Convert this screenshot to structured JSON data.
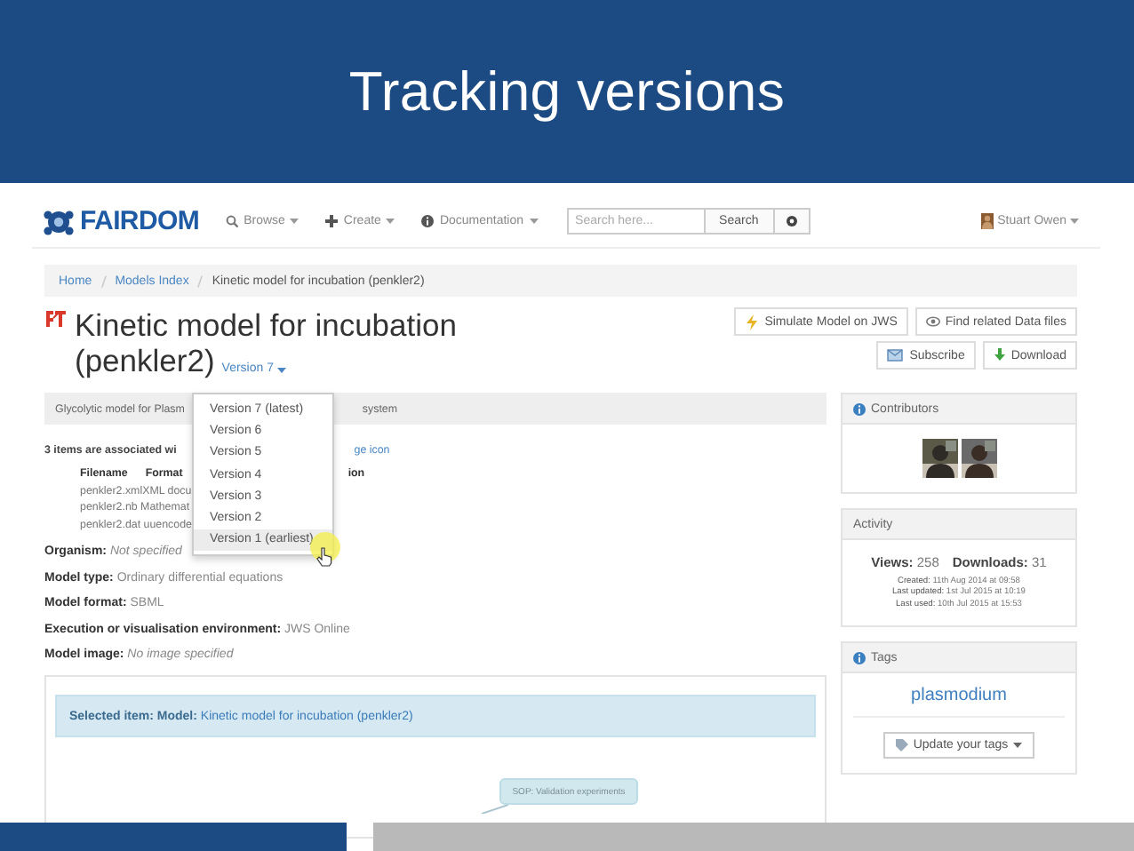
{
  "slide": {
    "title": "Tracking versions"
  },
  "navbar": {
    "logo": "FAIRDOM",
    "menus": [
      {
        "label": "Browse"
      },
      {
        "label": "Create"
      },
      {
        "label": "Documentation"
      }
    ],
    "search": {
      "placeholder": "Search here...",
      "button": "Search"
    },
    "user": "Stuart Owen"
  },
  "breadcrumb": [
    "Home",
    "Models Index",
    "Kinetic model for incubation (penkler2)"
  ],
  "title": [
    "Kinetic model for incubation",
    "(penkler2)"
  ],
  "version_menu": {
    "label": "Version 7",
    "expanded": true,
    "items": [
      {
        "label": "Version 7 (latest)",
        "selected": false
      },
      {
        "label": "Version 6",
        "selected": false
      },
      {
        "label": "Version 5",
        "selected": false
      },
      {
        "label": "Version 4",
        "selected": false
      },
      {
        "label": "Version 3",
        "selected": false
      },
      {
        "label": "Version 2",
        "selected": false
      },
      {
        "label": "Version 1 (earliest)",
        "selected": true
      }
    ]
  },
  "actions": [
    {
      "label": "Simulate Model on JWS"
    },
    {
      "label": "Find related Data files"
    },
    {
      "label": "Subscribe"
    },
    {
      "label": "Download"
    }
  ],
  "description": {
    "left": "Glycolytic model for Plasm",
    "right": "system"
  },
  "associated": {
    "text": "3 items are associated wi",
    "link": "ge icon"
  },
  "files": {
    "columns": [
      "Filename",
      "Format",
      "ion"
    ],
    "rows": [
      "penkler2.xmlXML docu",
      "penkler2.nb Mathemat",
      "penkler2.dat uuencode"
    ]
  },
  "fields": [
    {
      "label": "Organism:",
      "value": "Not specified",
      "kind": "empty"
    },
    {
      "label": "Model type:",
      "value": "Ordinary differential equations",
      "kind": "value"
    },
    {
      "label": "Model format:",
      "value": "SBML",
      "kind": "value"
    },
    {
      "label": "Execution or visualisation environment:",
      "value": "JWS Online",
      "kind": "value"
    },
    {
      "label": "Model image:",
      "value": "No image specified",
      "kind": "empty"
    }
  ],
  "selected_item": "**Selected item: Model:** Kinetic model for incubation (penkler2)",
  "graph": {
    "nodes": [
      "SOP: Validation experiments"
    ]
  },
  "sidebar": {
    "contributors": {
      "title": "Contributors"
    },
    "activity": {
      "title": "Activity",
      "views_label": "Views:",
      "views": "258",
      "downloads_label": "Downloads:",
      "downloads": "31",
      "lines": [
        {
          "label": "Created:",
          "value": "11th Aug 2014 at 09:58"
        },
        {
          "label": "Last updated:",
          "value": "1st Jul 2015 at 10:19"
        },
        {
          "label": "Last used:",
          "value": "10th Jul 2015 at 15:53"
        }
      ]
    },
    "tags": {
      "title": "Tags",
      "items": [
        "plasmodium"
      ],
      "button": "Update your tags"
    }
  }
}
